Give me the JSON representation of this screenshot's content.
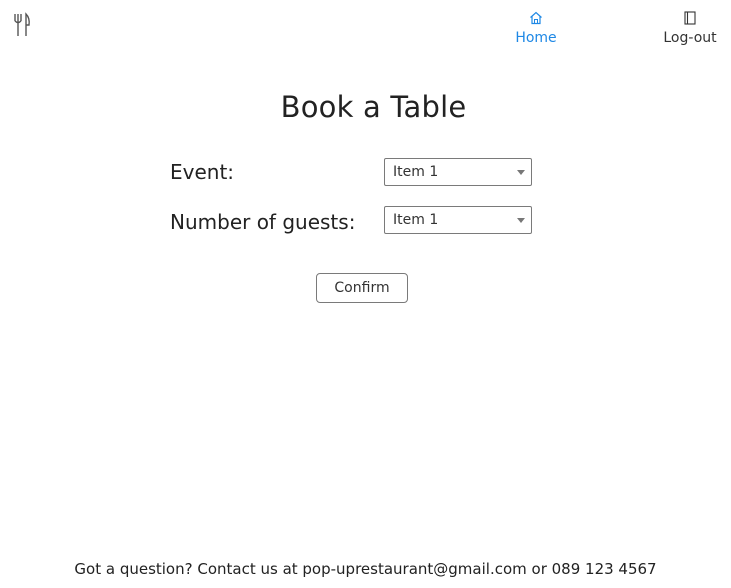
{
  "nav": {
    "logo_icon": "fork-knife-icon",
    "items": [
      {
        "label": "Home",
        "icon": "home-icon",
        "active": true,
        "color": "#1e88e5"
      },
      {
        "label": "Log-out",
        "icon": "book-icon",
        "active": false,
        "color": "#333333"
      }
    ]
  },
  "page": {
    "title": "Book a Table"
  },
  "form": {
    "event": {
      "label": "Event:",
      "selected": "Item 1"
    },
    "guests": {
      "label": "Number of guests:",
      "selected": "Item 1"
    },
    "confirm_label": "Confirm"
  },
  "footer": {
    "text": "Got a question? Contact us at pop-uprestaurant@gmail.com or 089 123 4567"
  }
}
